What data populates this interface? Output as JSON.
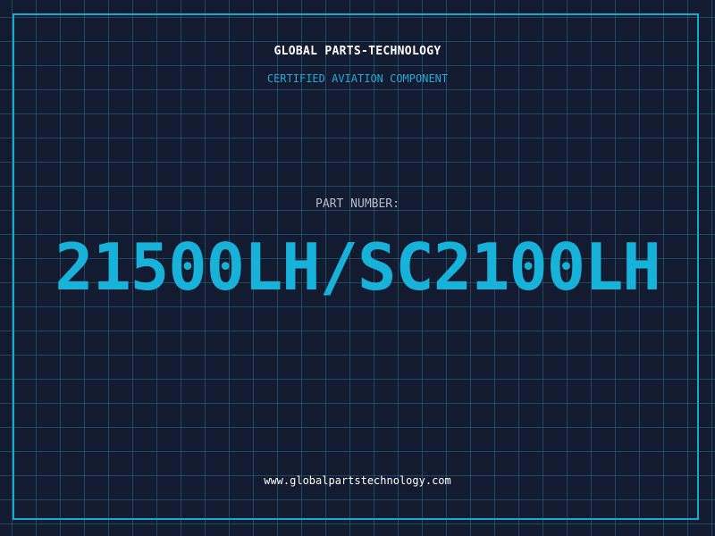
{
  "header": {
    "company": "GLOBAL PARTS-TECHNOLOGY",
    "subtitle": "CERTIFIED AVIATION COMPONENT"
  },
  "part": {
    "label": "PART NUMBER:",
    "number": "21500LH/SC2100LH"
  },
  "footer": {
    "website": "www.globalpartstechnology.com"
  },
  "colors": {
    "background": "#131b31",
    "grid": "#286e82",
    "accent": "#16b2da",
    "text": "#ffffff",
    "muted": "#b3bcc8"
  }
}
